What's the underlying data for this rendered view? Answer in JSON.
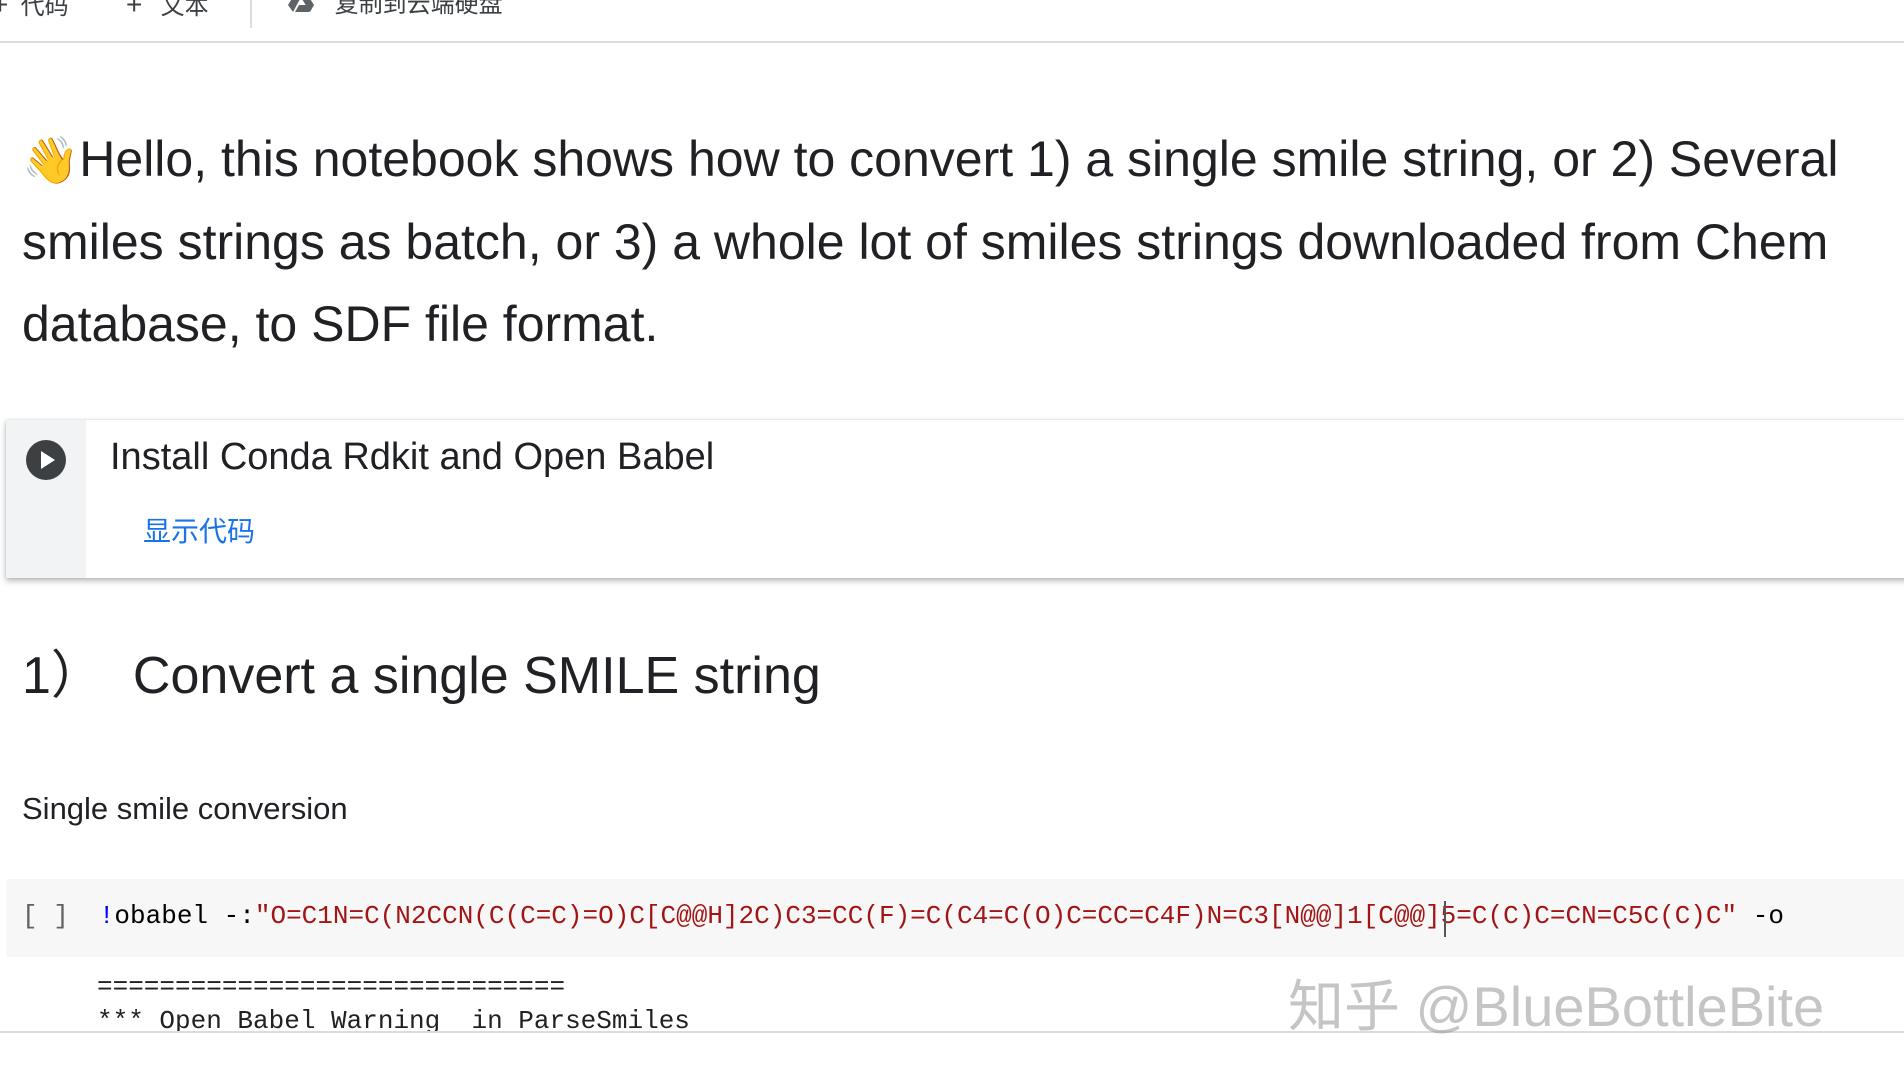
{
  "toolbar": {
    "add_code_label": "代码",
    "add_text_label": "文本",
    "copy_to_drive_label": "复制到云端硬盘"
  },
  "intro": {
    "emoji": "👋",
    "line1": "Hello, this notebook shows how to convert 1) a single smile string, or 2) Several",
    "line2": "smiles strings as batch, or 3) a whole lot of smiles strings downloaded from Chem",
    "line3": "database, to SDF file format."
  },
  "section": {
    "title": "Install Conda Rdkit and Open Babel",
    "show_code_label": "显示代码"
  },
  "heading": {
    "number": "1）",
    "text": "Convert a single SMILE string"
  },
  "subtext": "Single smile conversion",
  "code_cell": {
    "exec_count": "[ ]",
    "bang": "!",
    "command": "obabel -:",
    "smiles": "\"O=C1N=C(N2CCN(C(C=C)=O)C[C@@H]2C)C3=CC(F)=C(C4=C(O)C=CC=C4F)N=C3[N@@]1[C@@]5=C(C)C=CN=C5C(C)C\"",
    "rest": " -o"
  },
  "output": {
    "line1": "==============================",
    "line2": "*** Open Babel Warning  in ParseSmiles"
  },
  "watermark": "知乎 @BlueBottleBite",
  "colors": {
    "link": "#1a73e8",
    "string": "#a31515",
    "bang": "#0000ff",
    "gutter": "#f1f3f4",
    "code_bg": "#f7f7f7"
  }
}
